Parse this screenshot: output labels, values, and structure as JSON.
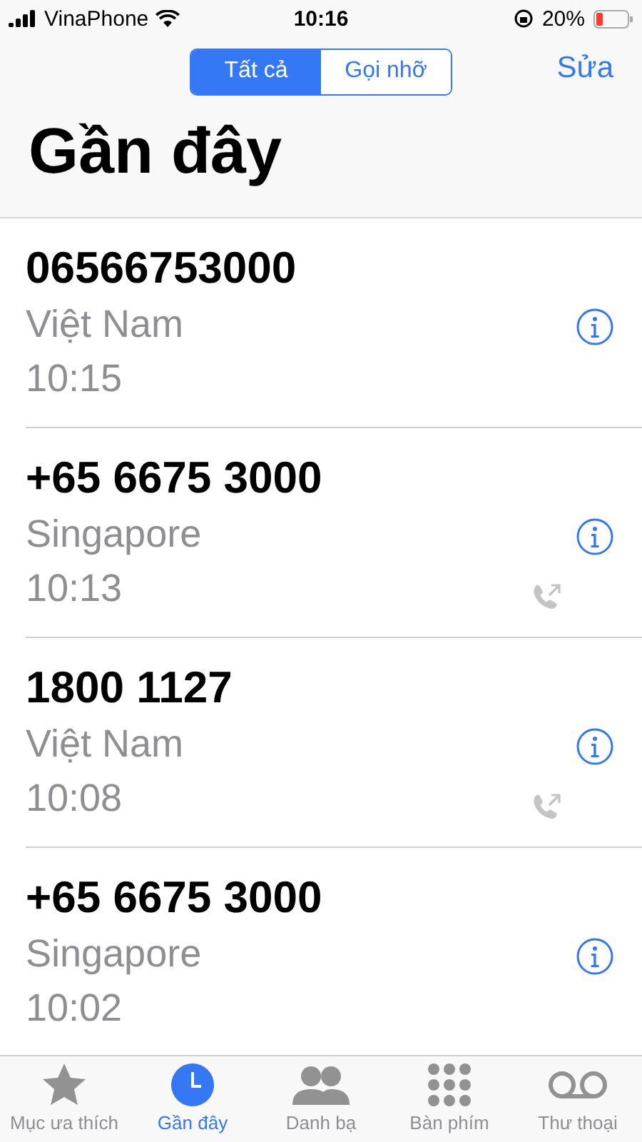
{
  "status_bar": {
    "carrier": "VinaPhone",
    "time": "10:16",
    "battery": "20%"
  },
  "segments": [
    {
      "label": "Tất cả",
      "selected": true
    },
    {
      "label": "Gọi nhỡ",
      "selected": false
    }
  ],
  "edit_button": "Sửa",
  "title": "Gần đây",
  "calls": [
    {
      "number": "06566753000",
      "location": "Việt Nam",
      "time": "10:15",
      "outgoing": false
    },
    {
      "number": "+65 6675 3000",
      "location": "Singapore",
      "time": "10:13",
      "outgoing": true
    },
    {
      "number": "1800 1127",
      "location": "Việt Nam",
      "time": "10:08",
      "outgoing": true
    },
    {
      "number": "+65 6675 3000",
      "location": "Singapore",
      "time": "10:02",
      "outgoing": false
    }
  ],
  "tab_bar": [
    {
      "kind": "star",
      "label": "Mục ưa thích",
      "selected": false
    },
    {
      "kind": "clock",
      "label": "Gần đây",
      "selected": true
    },
    {
      "kind": "contacts",
      "label": "Danh bạ",
      "selected": false
    },
    {
      "kind": "keypad",
      "label": "Bàn phím",
      "selected": false
    },
    {
      "kind": "voicemail",
      "label": "Thư thoại",
      "selected": false
    }
  ]
}
